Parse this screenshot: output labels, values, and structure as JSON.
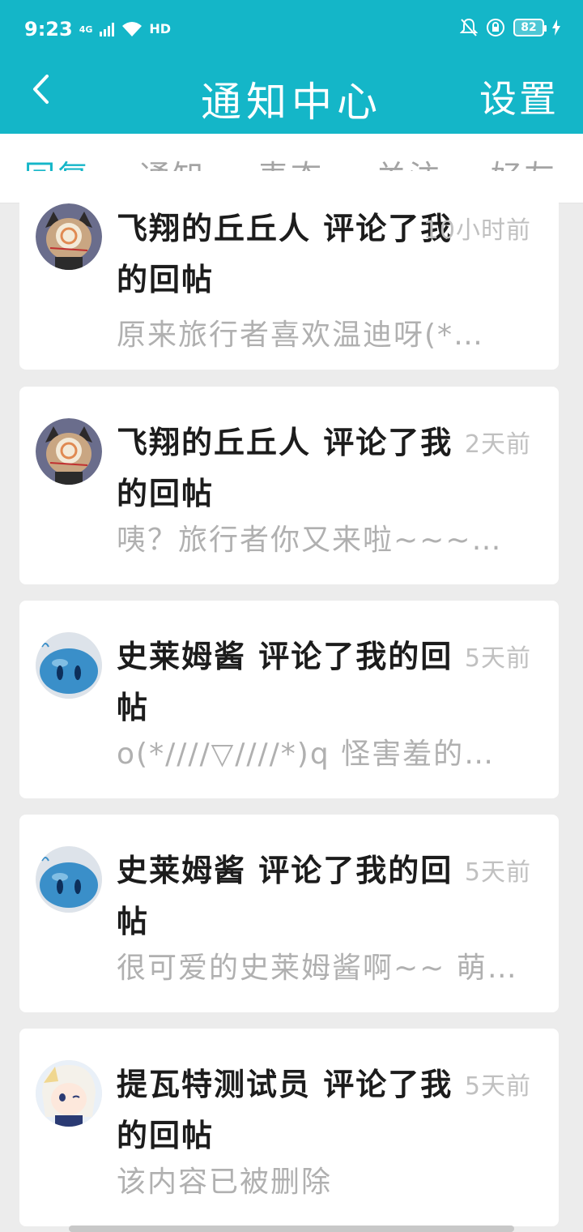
{
  "status_bar": {
    "time": "9:23",
    "network": "4G",
    "hd": "HD",
    "battery": "82"
  },
  "header": {
    "title": "通知中心",
    "settings_label": "设置"
  },
  "tabs": [
    {
      "label": "回复",
      "active": true
    },
    {
      "label": "通知",
      "active": false
    },
    {
      "label": "表态",
      "active": false
    },
    {
      "label": "关注",
      "active": false
    },
    {
      "label": "好友",
      "active": false
    }
  ],
  "notifications": [
    {
      "title": "飞翔的丘丘人 评论了我的回帖",
      "time": "10小时前",
      "preview": "原来旅行者喜欢温迪呀(*…",
      "avatar": "hilichurl-avatar"
    },
    {
      "title": "飞翔的丘丘人 评论了我的回帖",
      "time": "2天前",
      "preview": "咦？旅行者你又来啦~~~…",
      "avatar": "hilichurl-avatar"
    },
    {
      "title": "史莱姆酱 评论了我的回帖",
      "time": "5天前",
      "preview": "o(*////▽////*)q 怪害羞的…",
      "avatar": "slime-avatar"
    },
    {
      "title": "史莱姆酱 评论了我的回帖",
      "time": "5天前",
      "preview": "很可爱的史莱姆酱啊~~ 萌…",
      "avatar": "slime-avatar"
    },
    {
      "title": "提瓦特测试员 评论了我的回帖",
      "time": "5天前",
      "preview": "该内容已被删除",
      "avatar": "paimon-avatar"
    }
  ],
  "colors": {
    "accent": "#14b6c8",
    "background": "#ececec",
    "card": "#ffffff"
  }
}
